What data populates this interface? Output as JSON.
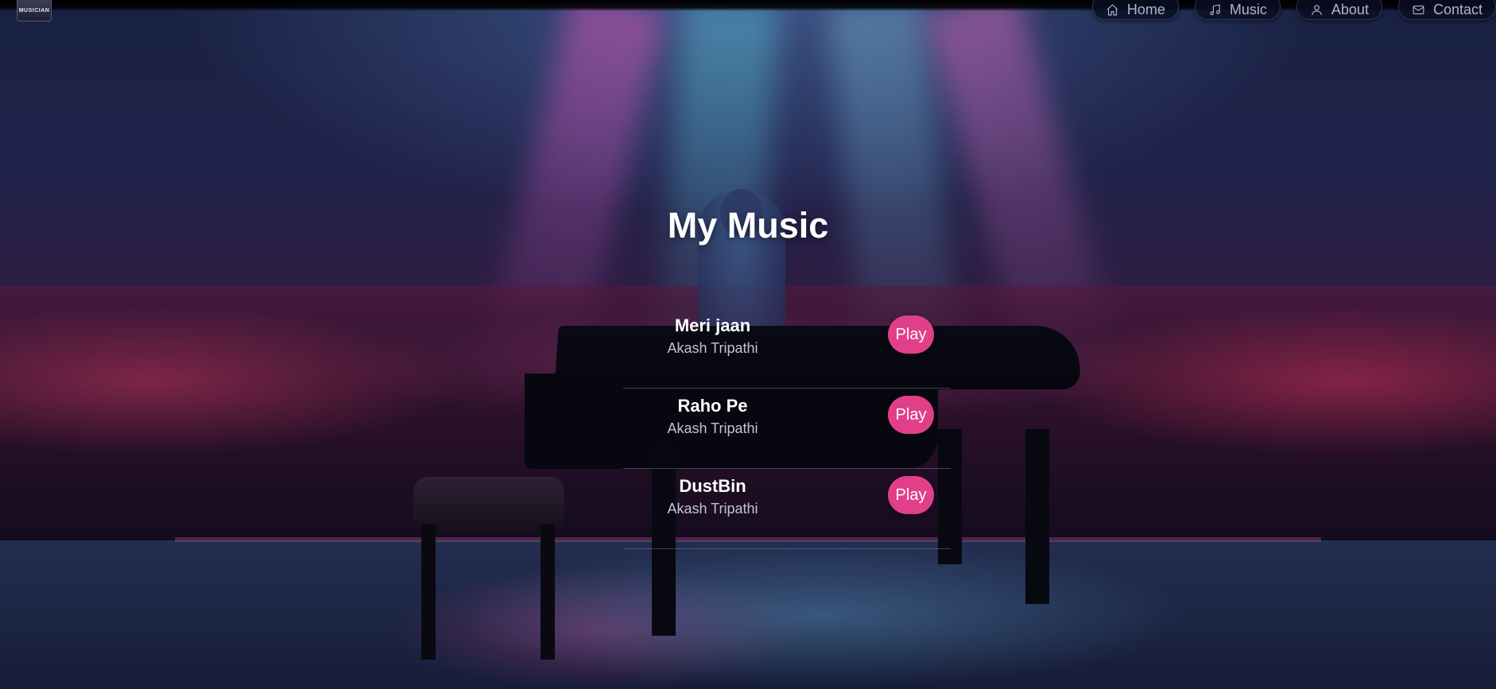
{
  "header": {
    "logo_text": "MUSICIAN",
    "nav": [
      {
        "label": "Home",
        "icon": "home-icon"
      },
      {
        "label": "Music",
        "icon": "music-note-icon"
      },
      {
        "label": "About",
        "icon": "user-icon"
      },
      {
        "label": "Contact",
        "icon": "mail-icon"
      }
    ]
  },
  "main": {
    "title": "My Music",
    "songs": [
      {
        "title": "Meri jaan",
        "artist": "Akash Tripathi",
        "action": "Play"
      },
      {
        "title": "Raho Pe",
        "artist": "Akash Tripathi",
        "action": "Play"
      },
      {
        "title": "DustBin",
        "artist": "Akash Tripathi",
        "action": "Play"
      }
    ]
  },
  "colors": {
    "accent": "#e23f8a",
    "nav_background": "#0a0e23",
    "text_primary": "#ffffff",
    "text_secondary": "#c2c4d2"
  }
}
